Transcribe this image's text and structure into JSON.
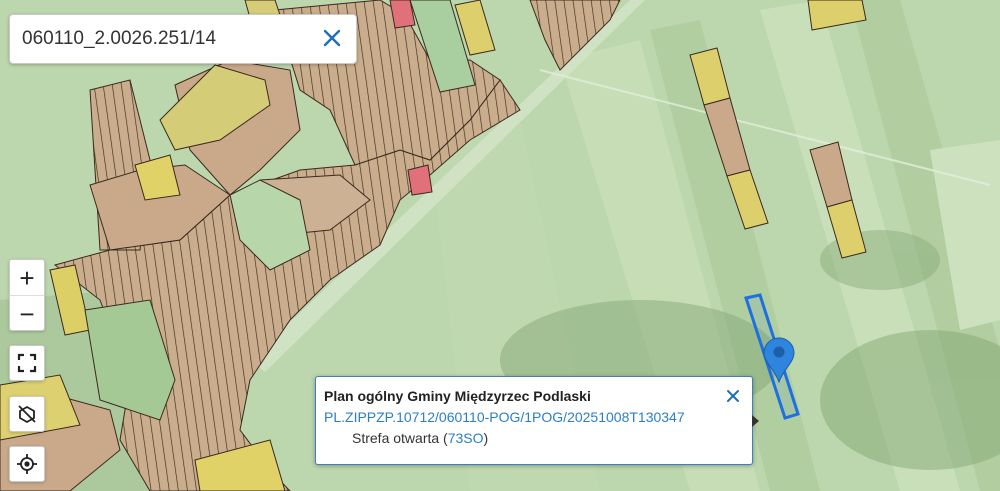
{
  "search": {
    "value": "060110_2.0026.251/14"
  },
  "controls": {
    "zoom_in_label": "+",
    "zoom_out_label": "−"
  },
  "popup": {
    "title": "Plan ogólny Gminy Międzyrzec Podlaski",
    "link": "PL.ZIPPZP.10712/060110-POG/1POG/20251008T130347",
    "zone_prefix": "Strefa otwarta (",
    "zone_code": "73SO",
    "zone_suffix": ")"
  },
  "colors": {
    "accent": "#2a7fc6",
    "selection_outline": "#1e6fe0",
    "zone_yellow": "#e8d266",
    "zone_brown": "#c9a98a",
    "zone_red": "#e0707a"
  },
  "icons": {
    "clear": "close-icon",
    "fullscreen": "fullscreen-icon",
    "layers_off": "layer-off-icon",
    "locate": "crosshair-icon",
    "marker": "map-marker-icon"
  }
}
